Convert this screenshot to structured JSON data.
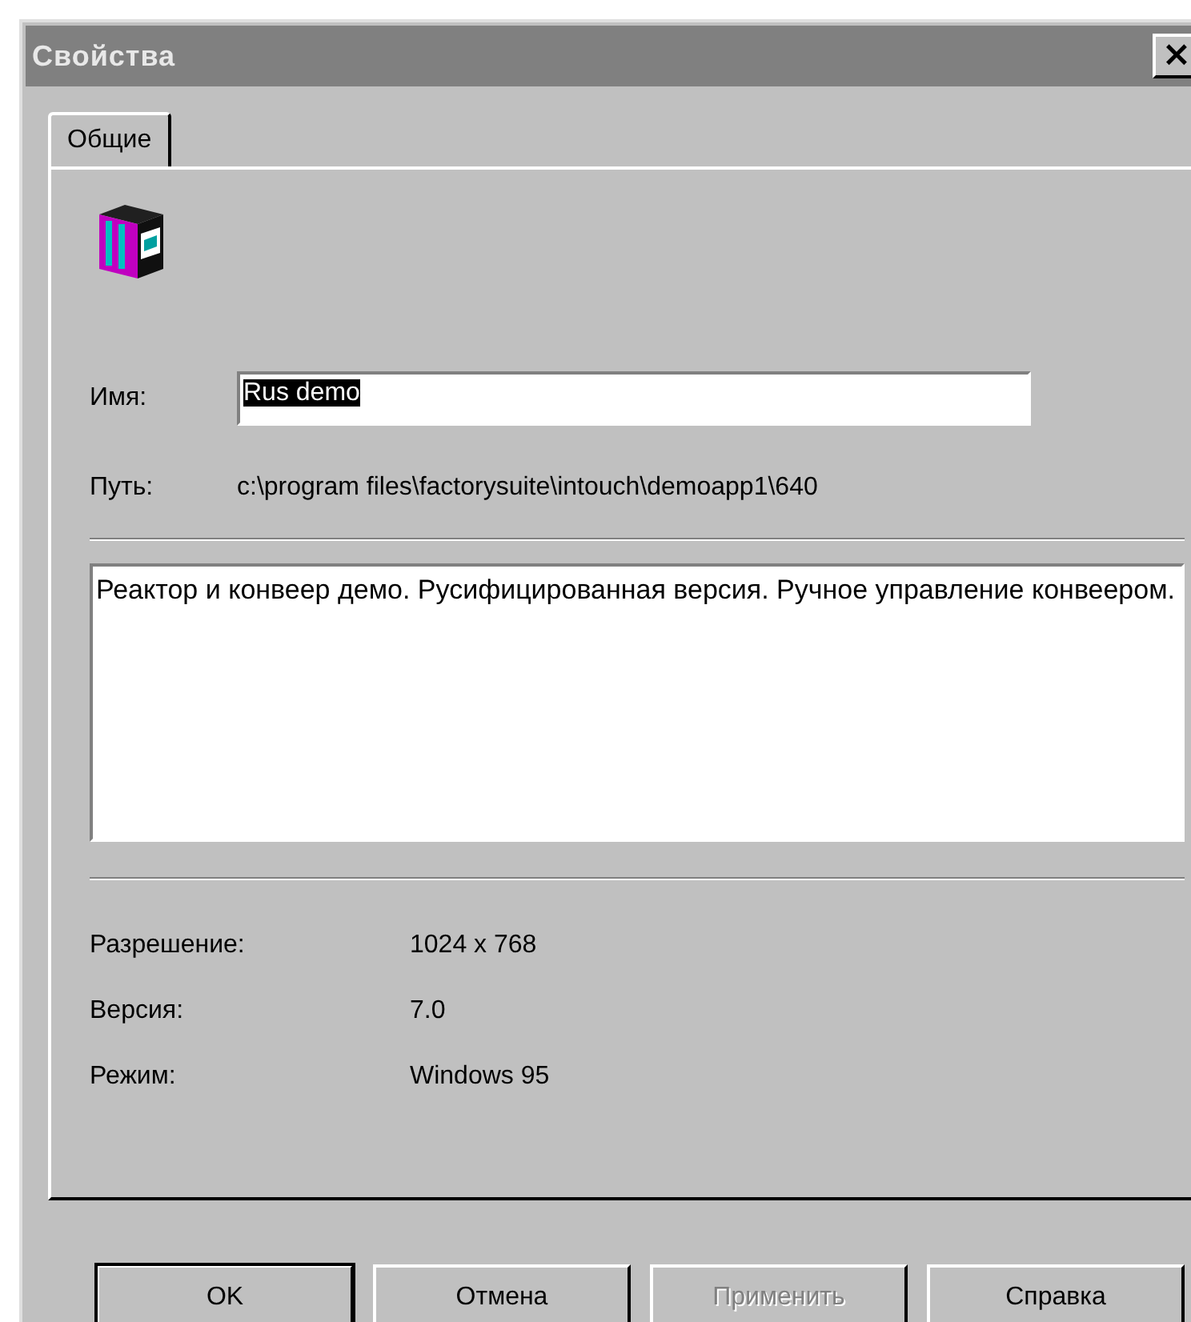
{
  "window": {
    "title": "Свойства",
    "close": "×"
  },
  "tabs": [
    {
      "label": "Общие",
      "selected": true
    }
  ],
  "name": {
    "label": "Имя:",
    "value": "Rus demo",
    "text_selected": true
  },
  "path": {
    "label": "Путь:",
    "value": "c:\\program files\\factorysuite\\intouch\\demoapp1\\640"
  },
  "description": "Реактор и конвеер демо. Русифицированная версия. Ручное управление конвеером.",
  "properties": [
    {
      "label": "Разрешение:",
      "value": "1024 x 768"
    },
    {
      "label": "Версия:",
      "value": "7.0"
    },
    {
      "label": "Режим:",
      "value": "Windows 95"
    }
  ],
  "buttons": [
    {
      "label": "OK",
      "default": true,
      "disabled": false
    },
    {
      "label": "Отмена",
      "default": false,
      "disabled": false
    },
    {
      "label": "Применить",
      "default": false,
      "disabled": true
    },
    {
      "label": "Справка",
      "default": false,
      "disabled": false
    }
  ]
}
